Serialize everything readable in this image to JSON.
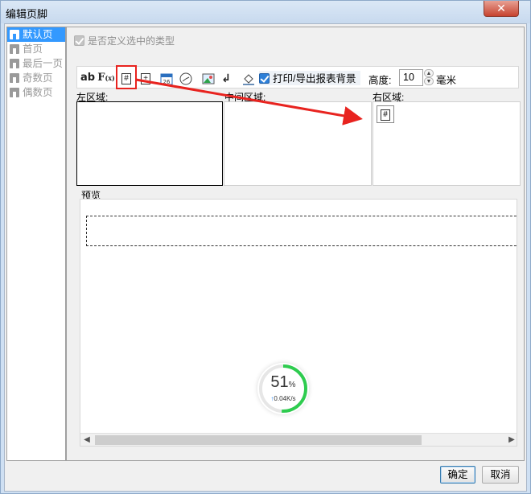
{
  "window": {
    "title": "编辑页脚",
    "close_glyph": "✕"
  },
  "sidebar": {
    "items": [
      {
        "label": "默认页",
        "state": "selected"
      },
      {
        "label": "首页",
        "state": "disabled"
      },
      {
        "label": "最后一页",
        "state": "disabled"
      },
      {
        "label": "奇数页",
        "state": "disabled"
      },
      {
        "label": "偶数页",
        "state": "disabled"
      }
    ]
  },
  "custom_type_checkbox": {
    "label": "是否定义选中的类型",
    "checked": true,
    "enabled": false
  },
  "toolbar": {
    "text_button": "ab",
    "formula_button": "F",
    "formula_sub": "(x)",
    "page_number_glyph": "#",
    "total_pages_glyph": "+",
    "date_glyph": "26",
    "print_bg_label": "打印/导出报表背景",
    "print_bg_checked": true,
    "height_label": "高度:",
    "height_value": "10",
    "height_unit": "毫米"
  },
  "regions": {
    "left_label": "左区域:",
    "middle_label": "中间区域:",
    "right_label": "右区域:",
    "right_inserted_glyph": "#"
  },
  "preview": {
    "label": "预览"
  },
  "gauge": {
    "percent": "51",
    "percent_sign": "%",
    "speed": "0.04K/s",
    "speed_arrow": "↑",
    "fraction": 0.51
  },
  "buttons": {
    "ok": "确定",
    "cancel": "取消"
  },
  "colors": {
    "accent": "#3399ff",
    "annotation_red": "#e8231f",
    "gauge_green": "#2ecc4f"
  }
}
